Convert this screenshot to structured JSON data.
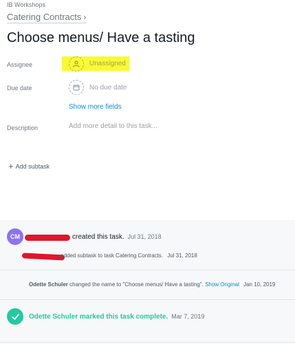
{
  "task": {
    "project": "IB Workshops",
    "breadcrumb": "Catering Contracts",
    "title": "Choose menus/ Have a tasting"
  },
  "fields": {
    "assignee_label": "Assignee",
    "assignee_value": "Unassigned",
    "due_label": "Due date",
    "due_value": "No due date",
    "show_more": "Show more fields",
    "description_label": "Description",
    "description_placeholder": "Add more detail to this task..."
  },
  "subtask": {
    "add_label": "Add subtask"
  },
  "activity": {
    "created": {
      "avatar": "CM",
      "text": "created this task.",
      "date": "Jul 31, 2018"
    },
    "subtask": {
      "text": "added subtask to task Catering Contracts.",
      "date": "Jul 31, 2018"
    },
    "rename": {
      "user": "Odette Schuler",
      "text": "changed the name to \"Choose menus/ Have a tasting\".",
      "link": "Show Original",
      "date": "Jan 10, 2019"
    },
    "complete": {
      "text": "Odette Schuler marked this task complete.",
      "date": "Mar 7, 2019"
    }
  },
  "colors": {
    "highlight": "#f9f936",
    "link": "#0d8ed4",
    "avatar": "#8d73ef",
    "complete": "#25c9a0",
    "redaction": "#e0162b"
  }
}
